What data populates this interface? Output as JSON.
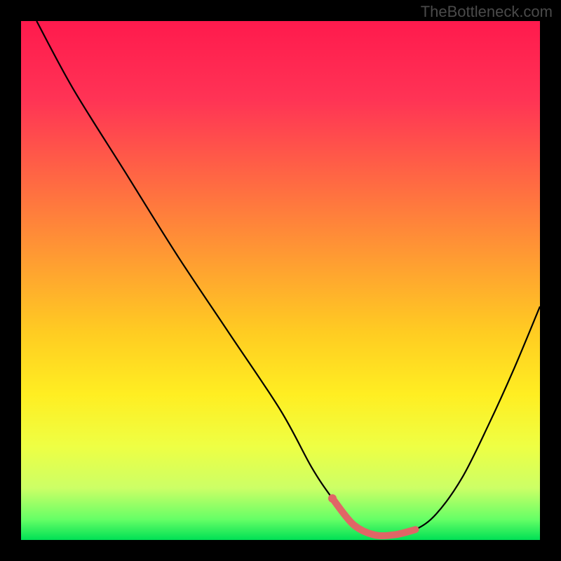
{
  "watermark": "TheBottleneck.com",
  "chart_data": {
    "type": "line",
    "title": "",
    "xlabel": "",
    "ylabel": "",
    "xlim": [
      0,
      100
    ],
    "ylim": [
      0,
      100
    ],
    "series": [
      {
        "name": "bottleneck-curve",
        "x": [
          3,
          10,
          20,
          30,
          40,
          50,
          56,
          60,
          64,
          68,
          72,
          76,
          80,
          85,
          90,
          95,
          100
        ],
        "y": [
          100,
          87,
          71,
          55,
          40,
          25,
          14,
          8,
          3,
          1,
          1,
          2,
          5,
          12,
          22,
          33,
          45
        ]
      }
    ],
    "highlight_segment": {
      "name": "optimal-range",
      "x": [
        60,
        64,
        68,
        72,
        76
      ],
      "y": [
        8,
        3,
        1,
        1,
        2
      ],
      "color": "#e06666"
    },
    "gradient_stops": [
      {
        "offset": 0.0,
        "color": "#ff1a4d"
      },
      {
        "offset": 0.15,
        "color": "#ff3355"
      },
      {
        "offset": 0.3,
        "color": "#ff6644"
      },
      {
        "offset": 0.45,
        "color": "#ff9933"
      },
      {
        "offset": 0.6,
        "color": "#ffcc22"
      },
      {
        "offset": 0.72,
        "color": "#ffee22"
      },
      {
        "offset": 0.82,
        "color": "#eeff44"
      },
      {
        "offset": 0.9,
        "color": "#ccff66"
      },
      {
        "offset": 0.96,
        "color": "#66ff66"
      },
      {
        "offset": 1.0,
        "color": "#00e055"
      }
    ]
  }
}
